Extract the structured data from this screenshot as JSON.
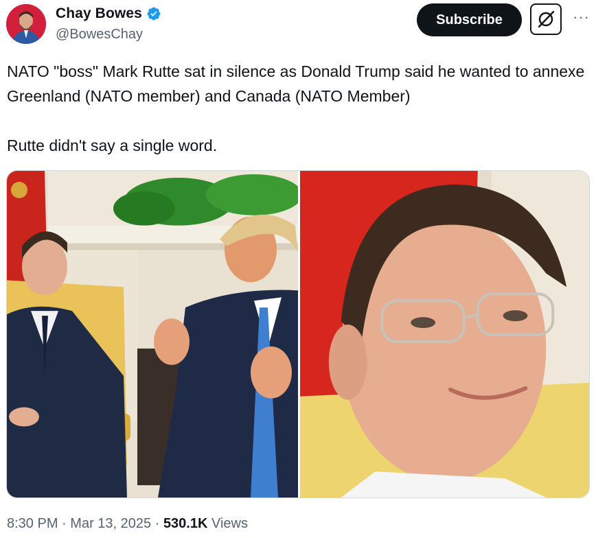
{
  "author": {
    "display_name": "Chay Bowes",
    "handle": "@BowesChay"
  },
  "actions": {
    "subscribe_label": "Subscribe",
    "more_label": "···"
  },
  "tweet": {
    "paragraphs": [
      "NATO \"boss\" Mark Rutte sat in silence as Donald Trump said he wanted to annexe Greenland (NATO member) and Canada (NATO Member)",
      "Rutte didn't say a single word."
    ]
  },
  "meta": {
    "time": "8:30 PM",
    "date": "Mar 13, 2025",
    "views_count": "530.1K",
    "views_label": "Views",
    "separator": "·"
  },
  "colors": {
    "text": "#0f1419",
    "secondary": "#536471",
    "verified": "#1d9bf0",
    "button": "#0f1419"
  },
  "icons": {
    "verified": "verified-badge-icon",
    "grok": "grok-icon",
    "more": "more-horizontal-icon"
  }
}
